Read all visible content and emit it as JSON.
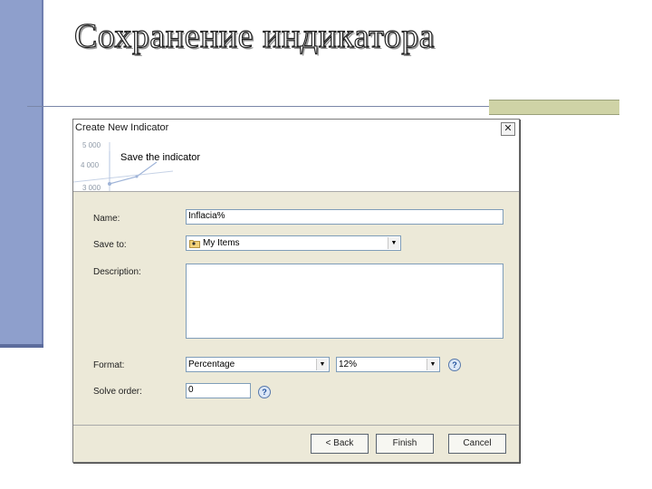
{
  "slide": {
    "title": "Сохранение индикатора"
  },
  "dialog": {
    "title": "Create New Indicator",
    "header_text": "Save the indicator",
    "banner_ticks": [
      "5 000",
      "4 000",
      "3 000"
    ],
    "fields": {
      "name_label": "Name:",
      "name_value": "Inflacia%",
      "save_to_label": "Save to:",
      "save_to_value": "My Items",
      "description_label": "Description:",
      "description_value": "",
      "format_label": "Format:",
      "format_value": "Percentage",
      "format_precision_value": "12%",
      "solve_order_label": "Solve order:",
      "solve_order_value": "0"
    },
    "help_glyph": "?",
    "close_glyph": "✕",
    "buttons": {
      "back": "< Back",
      "finish": "Finish",
      "cancel": "Cancel"
    }
  },
  "colors": {
    "slide_bar": "#8e9fcc",
    "dialog_bg": "#ece9d8",
    "input_border": "#7f9db9",
    "accent_band": "#cfd3a6"
  }
}
